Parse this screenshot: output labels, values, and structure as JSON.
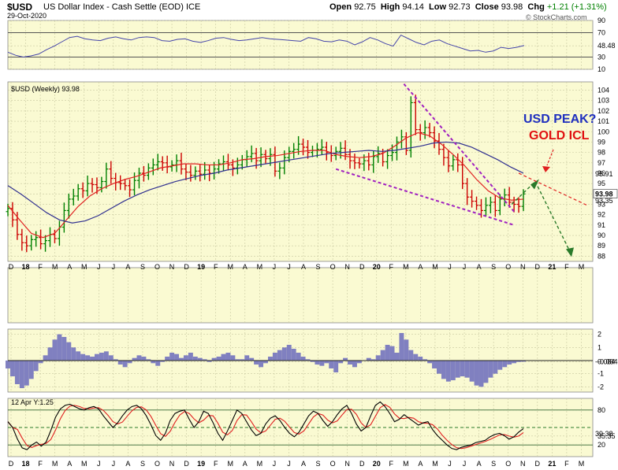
{
  "header": {
    "symbol": "$USD",
    "name": "US Dollar Index - Cash Settle (EOD)",
    "exchange": "ICE",
    "date": "29-Oct-2020",
    "open_label": "Open",
    "open": "92.75",
    "high_label": "High",
    "high": "94.14",
    "low_label": "Low",
    "low": "92.73",
    "close_label": "Close",
    "close": "93.98",
    "chg_label": "Chg",
    "chg": "+1.21 (+1.31%)",
    "credit": "© StockCharts.com"
  },
  "colors": {
    "panel_bg": "#fafad2",
    "up": "#008000",
    "down": "#cc0000",
    "ma_fast": "#e02020",
    "ma_slow": "#303090",
    "wedge": "#a020c0",
    "rsi": "#4444aa",
    "macd_fill": "#8080c0",
    "stoch_k": "#000000",
    "stoch_d": "#e02020"
  },
  "chart_data": [
    {
      "type": "line",
      "name": "rsi-panel",
      "yticks": [
        90,
        70,
        48.48,
        30,
        10
      ],
      "ylim": [
        10,
        90
      ],
      "series": [
        {
          "name": "RSI",
          "y": [
            38,
            33,
            30,
            32,
            35,
            42,
            48,
            55,
            62,
            64,
            60,
            58,
            57,
            61,
            63,
            60,
            58,
            62,
            63,
            62,
            57,
            56,
            59,
            60,
            56,
            54,
            57,
            61,
            62,
            59,
            57,
            58,
            60,
            62,
            60,
            59,
            58,
            57,
            56,
            62,
            60,
            56,
            55,
            58,
            56,
            50,
            55,
            62,
            58,
            52,
            48,
            66,
            60,
            54,
            50,
            56,
            58,
            52,
            48,
            44,
            40,
            41,
            38,
            40,
            46,
            44,
            46,
            49
          ]
        }
      ],
      "levels": [
        70,
        30
      ]
    },
    {
      "type": "bar",
      "name": "price-panel",
      "title": "$USD (Weekly) 93.98",
      "yticks": [
        104,
        103,
        102,
        101,
        100,
        99,
        98,
        97,
        96,
        95,
        94,
        93,
        92,
        91,
        90,
        89,
        88
      ],
      "ylim": [
        87.5,
        104.8
      ],
      "last_value": "93.98",
      "ma_labels": [
        "95.91",
        "93.35"
      ],
      "x_labels": [
        "D",
        "18",
        "F",
        "M",
        "A",
        "M",
        "J",
        "J",
        "A",
        "S",
        "O",
        "N",
        "D",
        "19",
        "F",
        "M",
        "A",
        "M",
        "J",
        "J",
        "A",
        "S",
        "O",
        "N",
        "D",
        "20",
        "F",
        "M",
        "A",
        "M",
        "J",
        "J",
        "A",
        "S",
        "O",
        "N",
        "D",
        "21",
        "F",
        "M"
      ],
      "closes": [
        92.6,
        91.5,
        90.1,
        89.3,
        89.0,
        89.6,
        89.8,
        89.2,
        89.5,
        90.1,
        89.7,
        90.8,
        92.4,
        93.5,
        93.8,
        94.5,
        94.3,
        95.0,
        94.9,
        94.6,
        95.2,
        96.4,
        95.5,
        95.1,
        95.0,
        94.8,
        94.4,
        95.3,
        96.0,
        95.8,
        96.5,
        96.8,
        97.1,
        97.0,
        96.6,
        96.8,
        97.2,
        96.4,
        96.1,
        95.8,
        96.2,
        95.9,
        96.3,
        96.0,
        96.4,
        96.9,
        97.1,
        96.8,
        96.5,
        96.8,
        97.3,
        97.6,
        97.9,
        97.2,
        97.8,
        97.4,
        97.8,
        96.2,
        96.5,
        97.5,
        98.1,
        98.3,
        98.8,
        98.5,
        98.0,
        98.2,
        98.3,
        98.5,
        98.0,
        97.7,
        98.1,
        98.4,
        97.8,
        97.2,
        97.0,
        96.9,
        97.2,
        96.8,
        97.6,
        97.9,
        97.1,
        97.7,
        98.0,
        99.0,
        99.5,
        98.2,
        102.8,
        100.2,
        99.9,
        100.4,
        99.9,
        99.1,
        98.3,
        97.5,
        96.7,
        97.3,
        96.8,
        95.0,
        93.7,
        93.3,
        92.9,
        92.4,
        92.9,
        93.2,
        92.4,
        93.5,
        93.9,
        93.2,
        93.0,
        92.8,
        94.0
      ],
      "ma_fast_points": [
        92.9,
        91.5,
        90.2,
        89.8,
        90.2,
        91.5,
        92.8,
        93.8,
        94.5,
        95.0,
        95.4,
        95.7,
        96.1,
        96.5,
        96.7,
        96.9,
        96.9,
        96.8,
        96.8,
        97.0,
        97.3,
        97.4,
        97.6,
        97.7,
        97.9,
        98.1,
        98.2,
        98.2,
        97.8,
        97.6,
        97.5,
        97.6,
        97.9,
        98.6,
        99.4,
        99.9,
        99.6,
        98.8,
        97.8,
        96.7,
        95.4,
        94.3,
        93.6,
        93.4,
        93.5
      ],
      "ma_slow_points": [
        94.8,
        94.0,
        93.1,
        92.2,
        91.5,
        91.2,
        91.4,
        91.9,
        92.6,
        93.3,
        93.9,
        94.4,
        94.8,
        95.2,
        95.5,
        95.8,
        96.0,
        96.3,
        96.5,
        96.7,
        96.9,
        97.1,
        97.3,
        97.5,
        97.7,
        97.9,
        98.0,
        98.1,
        98.2,
        98.1,
        98.2,
        98.4,
        98.6,
        98.9,
        99.0,
        98.9,
        98.5,
        97.9,
        97.3,
        96.6,
        96.0
      ],
      "annotations": [
        "USD PEAK?",
        "GOLD ICL"
      ],
      "projection": {
        "rise_to": 95.2,
        "fall_to": 88.0
      }
    },
    {
      "type": "area",
      "name": "macd-histogram-panel",
      "yticks": [
        2,
        1,
        -0.084,
        -1,
        -2
      ],
      "ylim": [
        -2.4,
        2.4
      ],
      "last_value": "-0.084"
    },
    {
      "type": "line",
      "name": "stochastic-panel",
      "title": "12 Apr Y:1.25",
      "yticks": [
        80,
        35.35,
        20
      ],
      "ylim": [
        0,
        100
      ],
      "last_values": [
        "35.35",
        "39.38"
      ],
      "levels": [
        80,
        50,
        20
      ],
      "x_labels": [
        "D",
        "18",
        "F",
        "M",
        "A",
        "M",
        "J",
        "J",
        "A",
        "S",
        "O",
        "N",
        "D",
        "19",
        "F",
        "M",
        "A",
        "M",
        "J",
        "J",
        "A",
        "S",
        "O",
        "N",
        "D",
        "20",
        "F",
        "M",
        "A",
        "M",
        "J",
        "J",
        "A",
        "S",
        "O",
        "N",
        "D",
        "21",
        "F",
        "M"
      ]
    }
  ]
}
